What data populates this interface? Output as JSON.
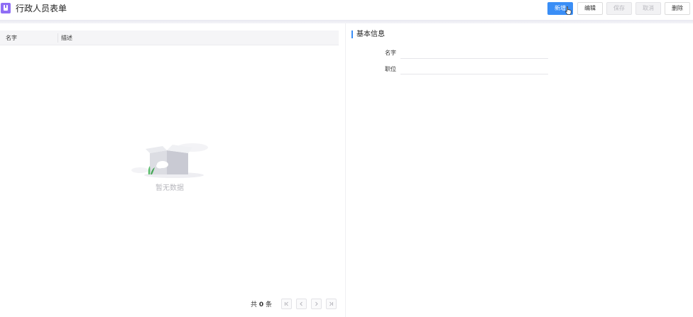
{
  "header": {
    "title": "行政人员表单",
    "buttons": {
      "add": "新增",
      "edit": "编辑",
      "save": "保存",
      "cancel": "取消",
      "delete": "删除"
    }
  },
  "table": {
    "columns": [
      "名字",
      "描述"
    ],
    "rows": [],
    "empty_text": "暂无数据"
  },
  "pagination": {
    "total_prefix": "共",
    "total_count": "0",
    "total_suffix": "条"
  },
  "form": {
    "section_title": "基本信息",
    "fields": [
      {
        "label": "名字",
        "value": ""
      },
      {
        "label": "职位",
        "value": ""
      }
    ]
  },
  "colors": {
    "primary": "#3a8ef6",
    "app_icon": "#8f6ef5"
  },
  "icons": {
    "app": "document-icon",
    "first": "first-page-icon",
    "prev": "chevron-left-icon",
    "next": "chevron-right-icon",
    "last": "last-page-icon",
    "empty": "empty-box-icon",
    "cursor": "hand-cursor-icon"
  }
}
